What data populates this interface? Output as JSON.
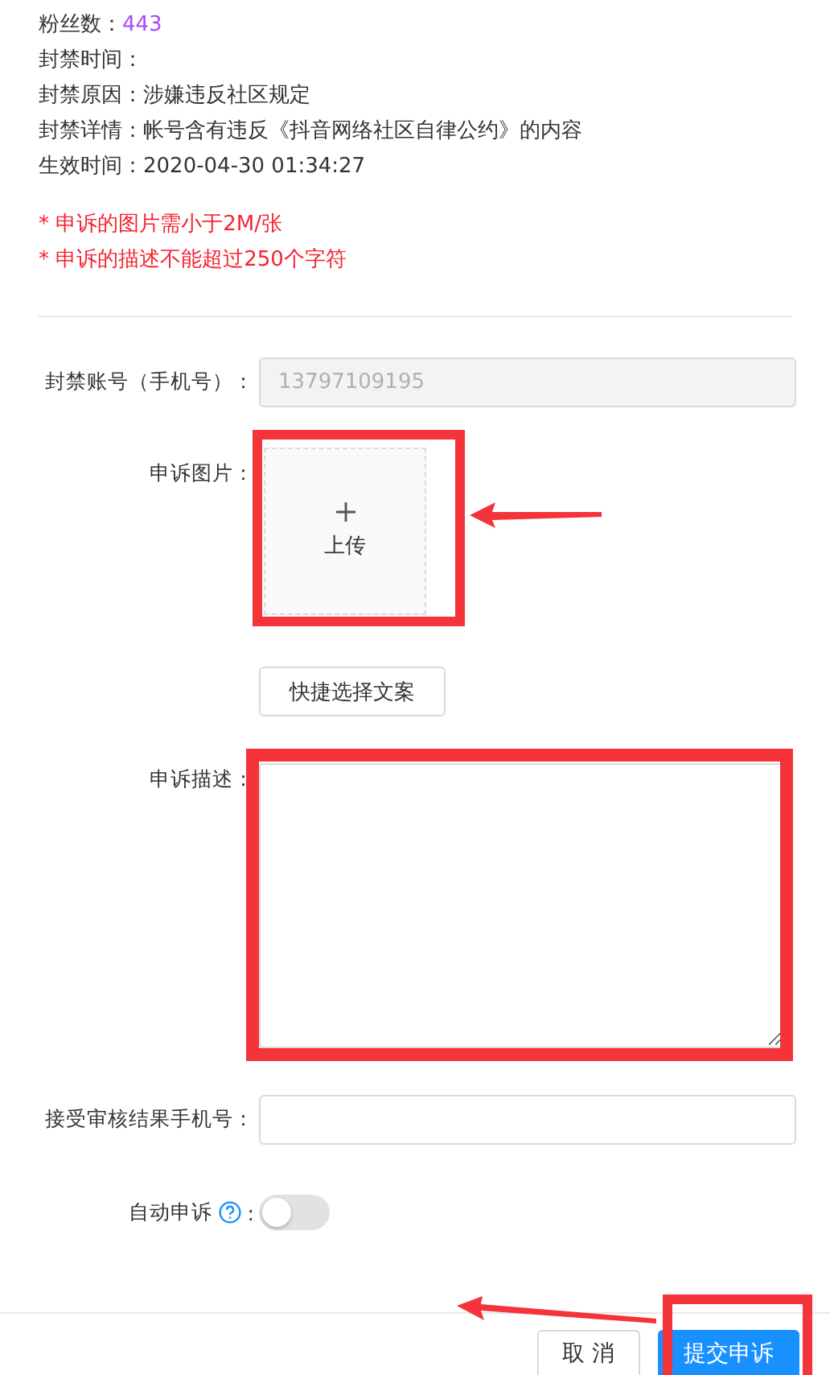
{
  "info": [
    {
      "label": "粉丝数：",
      "value": "443",
      "kind": "count"
    },
    {
      "label": "封禁时间：",
      "kind": "text"
    },
    {
      "label": "封禁原因：",
      "value": "涉嫌违反社区规定",
      "kind": "text"
    },
    {
      "label": "封禁详情：",
      "value": "帐号含有违反《抖音网络社区自律公约》的内容",
      "kind": "text"
    },
    {
      "label": "生效时间：",
      "value": "2020-04-30 01:34:27",
      "kind": "text"
    }
  ],
  "notes": [
    {
      "marker": "*",
      "text": "申诉的图片需小于2M/张"
    },
    {
      "marker": "*",
      "text": "申诉的描述不能超过250个字符"
    }
  ],
  "form": {
    "account": {
      "label": "封禁账号（手机号）：",
      "value": "13797109195",
      "disabled": true
    },
    "upload": {
      "label": "申诉图片：",
      "text": "上传"
    },
    "quick_button": "快捷选择文案",
    "description": {
      "label": "申诉描述："
    },
    "phone": {
      "label": "接受审核结果手机号："
    },
    "auto_appeal": {
      "label": "自动申诉",
      "colon": ":",
      "on": false
    }
  },
  "footer": {
    "buttons": [
      {
        "label": "取 消",
        "kind": "default"
      },
      {
        "label": "提交申诉",
        "kind": "primary"
      }
    ]
  }
}
